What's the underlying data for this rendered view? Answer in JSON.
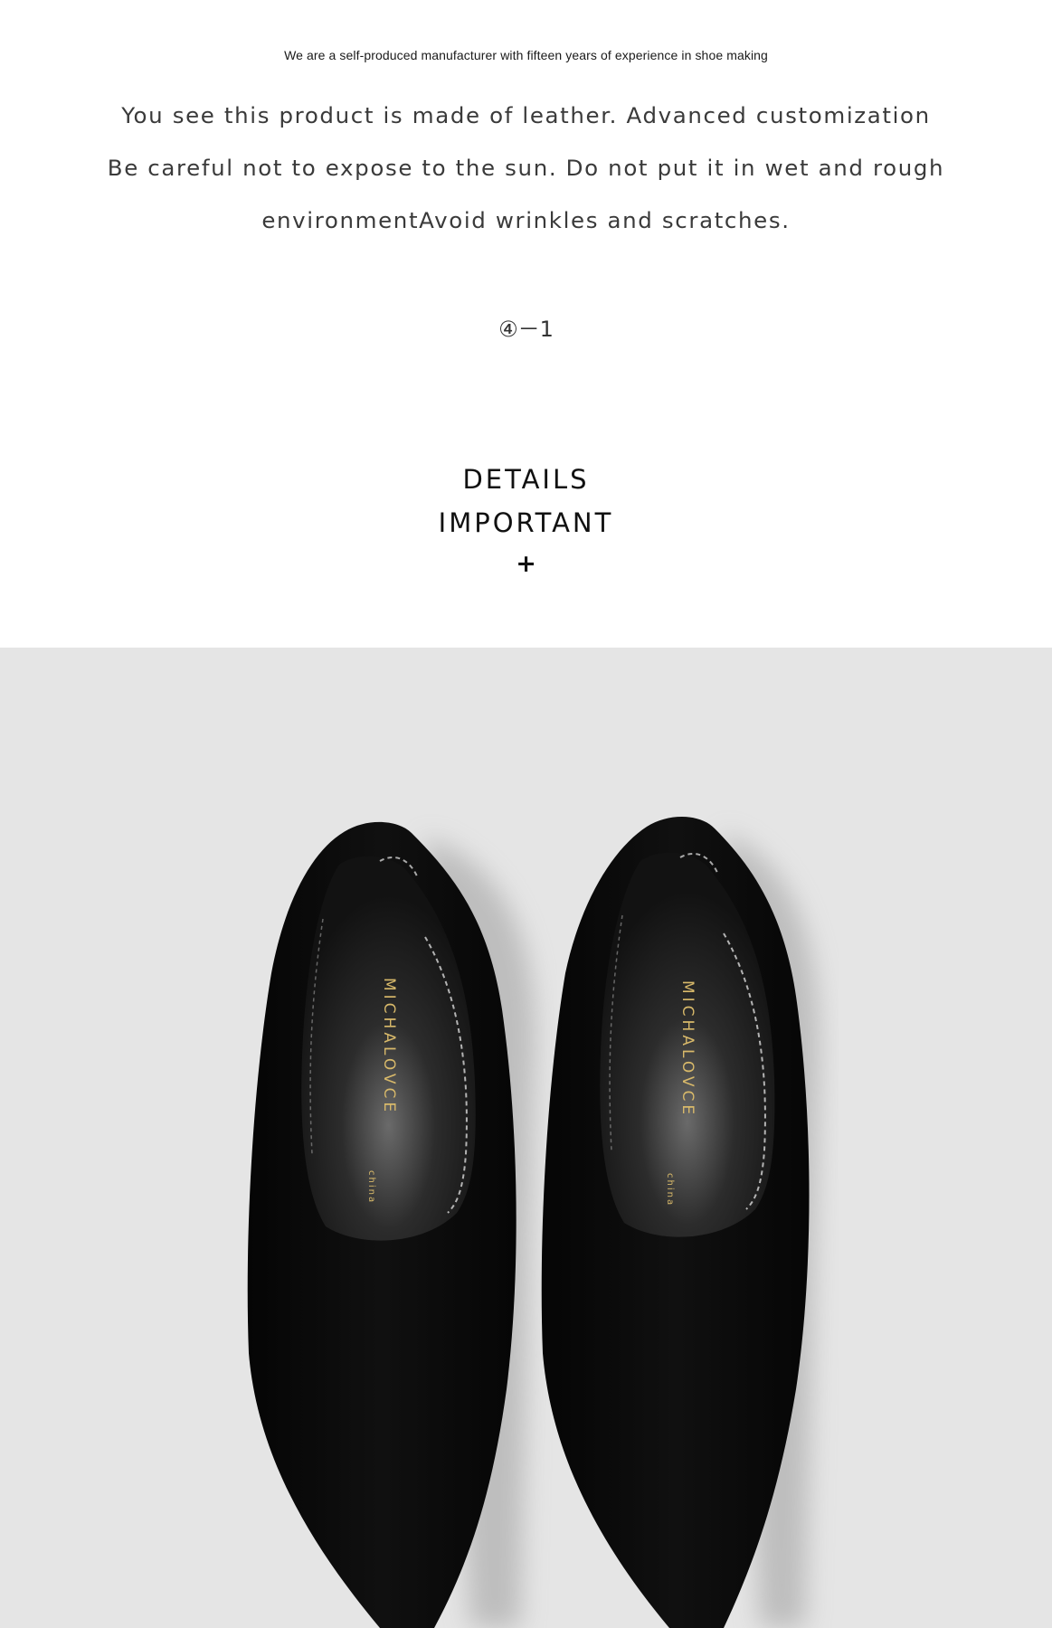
{
  "intro": {
    "tagline": "We are a self-produced manufacturer with fifteen years of experience in shoe making",
    "care_lines": [
      "You see this product is made of leather. Advanced customization",
      "Be careful not to expose to the sun. Do not put it in wet and rough",
      "environmentAvoid wrinkles and scratches."
    ],
    "page_index": "④－1"
  },
  "details": {
    "heading_line1": "DETAILS",
    "heading_line2": "IMPORTANT",
    "plus": "+"
  },
  "product_photo": {
    "insole_brand": "MICHALOVCE",
    "insole_sub": "china",
    "background": "#e5e5e5",
    "shoe_color": "#0b0b0b"
  }
}
